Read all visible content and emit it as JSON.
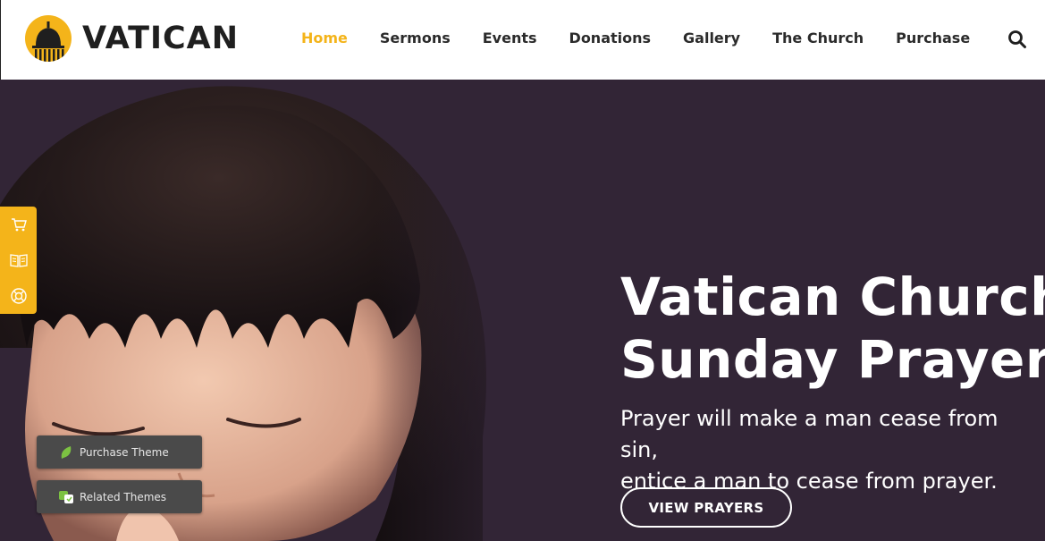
{
  "brand": {
    "name": "VATICAN"
  },
  "nav": {
    "items": [
      {
        "label": "Home",
        "active": true
      },
      {
        "label": "Sermons"
      },
      {
        "label": "Events"
      },
      {
        "label": "Donations"
      },
      {
        "label": "Gallery"
      },
      {
        "label": "The Church"
      },
      {
        "label": "Purchase"
      }
    ],
    "search_icon": "search-icon"
  },
  "hero": {
    "title_line1": "Vatican Church",
    "title_line2": "Sunday Prayers",
    "subtitle_line1": "Prayer will make a man cease from sin,",
    "subtitle_line2": "entice a man to cease from prayer.",
    "button_label": "VIEW PRAYERS"
  },
  "sidebar": {
    "icons": [
      "cart-icon",
      "book-icon",
      "lifebuoy-icon"
    ]
  },
  "floating": {
    "purchase_label": "Purchase Theme",
    "related_label": "Related Themes"
  },
  "colors": {
    "accent": "#f4b41a",
    "hero_bg": "#322536",
    "text_dark": "#2b2b2b",
    "float_bg": "#4a4a4a"
  }
}
